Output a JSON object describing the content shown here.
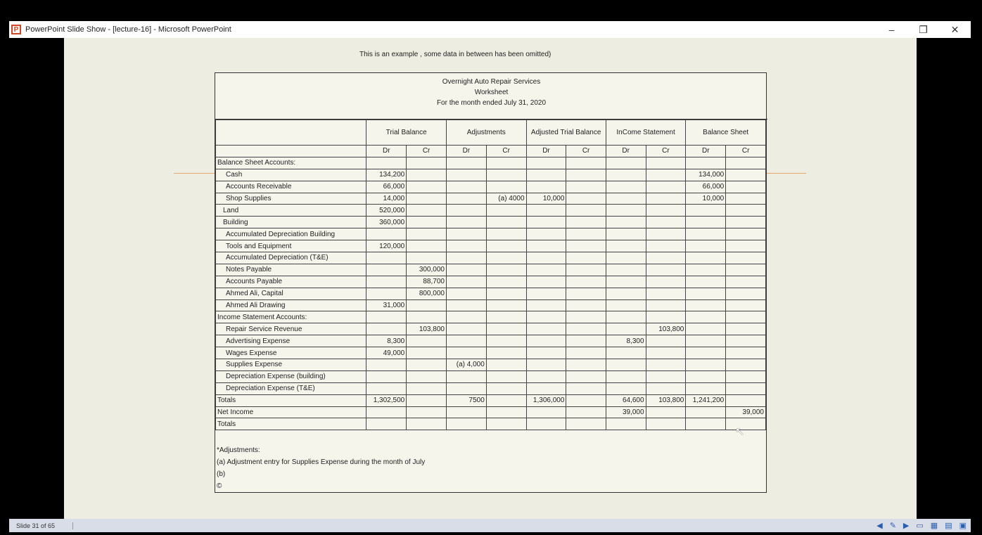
{
  "window": {
    "title": "PowerPoint Slide Show - [lecture-16] - Microsoft PowerPoint",
    "minimize": "–",
    "restore": "❐",
    "close": "✕"
  },
  "slide": {
    "note": "This is an example  , some data in between has been omitted)",
    "company": "Overnight Auto Repair Services",
    "doc_title": "Worksheet",
    "period": "For the month ended July  31, 2020",
    "col_groups": [
      "Trial Balance",
      "Adjustments",
      "Adjusted Trial Balance",
      "InCome Statement",
      "Balance Sheet"
    ],
    "dr": "Dr",
    "cr": "Cr",
    "rows": [
      {
        "label": "Balance Sheet Accounts:",
        "cls": "",
        "v": [
          "",
          "",
          "",
          "",
          "",
          "",
          "",
          "",
          "",
          ""
        ]
      },
      {
        "label": "Cash",
        "cls": "ind1",
        "v": [
          "134,200",
          "",
          "",
          "",
          "",
          "",
          "",
          "",
          "134,000",
          ""
        ]
      },
      {
        "label": "Accounts Receivable",
        "cls": "ind1",
        "v": [
          "66,000",
          "",
          "",
          "",
          "",
          "",
          "",
          "",
          "66,000",
          ""
        ]
      },
      {
        "label": "Shop Supplies",
        "cls": "ind1",
        "v": [
          "14,000",
          "",
          "",
          "(a)  4000",
          "10,000",
          "",
          "",
          "",
          "10,000",
          ""
        ]
      },
      {
        "label": "Land",
        "cls": "ind2",
        "v": [
          "520,000",
          "",
          "",
          "",
          "",
          "",
          "",
          "",
          "",
          ""
        ]
      },
      {
        "label": "Building",
        "cls": "ind2",
        "v": [
          "360,000",
          "",
          "",
          "",
          "",
          "",
          "",
          "",
          "",
          ""
        ]
      },
      {
        "label": "Accumulated Depreciation Building",
        "cls": "ind1",
        "v": [
          "",
          "",
          "",
          "",
          "",
          "",
          "",
          "",
          "",
          ""
        ]
      },
      {
        "label": "Tools and Equipment",
        "cls": "ind1",
        "v": [
          "120,000",
          "",
          "",
          "",
          "",
          "",
          "",
          "",
          "",
          ""
        ]
      },
      {
        "label": "Accumulated Depreciation (T&E)",
        "cls": "ind1",
        "v": [
          "",
          "",
          "",
          "",
          "",
          "",
          "",
          "",
          "",
          ""
        ]
      },
      {
        "label": "Notes Payable",
        "cls": "ind1",
        "v": [
          "",
          "300,000",
          "",
          "",
          "",
          "",
          "",
          "",
          "",
          ""
        ]
      },
      {
        "label": "Accounts Payable",
        "cls": "ind1",
        "v": [
          "",
          "88,700",
          "",
          "",
          "",
          "",
          "",
          "",
          "",
          ""
        ]
      },
      {
        "label": "Ahmed Ali, Capital",
        "cls": "ind1",
        "v": [
          "",
          "800,000",
          "",
          "",
          "",
          "",
          "",
          "",
          "",
          ""
        ]
      },
      {
        "label": "Ahmed Ali Drawing",
        "cls": "ind1",
        "v": [
          "31,000",
          "",
          "",
          "",
          "",
          "",
          "",
          "",
          "",
          ""
        ]
      },
      {
        "label": "Income Statement Accounts:",
        "cls": "",
        "v": [
          "",
          "",
          "",
          "",
          "",
          "",
          "",
          "",
          "",
          ""
        ]
      },
      {
        "label": "Repair Service Revenue",
        "cls": "ind1",
        "v": [
          "",
          "103,800",
          "",
          "",
          "",
          "",
          "",
          "103,800",
          "",
          ""
        ]
      },
      {
        "label": "Advertising Expense",
        "cls": "ind1",
        "v": [
          "8,300",
          "",
          "",
          "",
          "",
          "",
          "8,300",
          "",
          "",
          ""
        ]
      },
      {
        "label": "Wages Expense",
        "cls": "ind1",
        "v": [
          "49,000",
          "",
          "",
          "",
          "",
          "",
          "",
          "",
          "",
          ""
        ]
      },
      {
        "label": "Supplies Expense",
        "cls": "ind1",
        "v": [
          "",
          "",
          "(a)  4,000",
          "",
          "",
          "",
          "",
          "",
          "",
          ""
        ]
      },
      {
        "label": "Depreciation Expense (building)",
        "cls": "ind1",
        "v": [
          "",
          "",
          "",
          "",
          "",
          "",
          "",
          "",
          "",
          ""
        ]
      },
      {
        "label": "Depreciation Expense (T&E)",
        "cls": "ind1",
        "v": [
          "",
          "",
          "",
          "",
          "",
          "",
          "",
          "",
          "",
          ""
        ]
      },
      {
        "label": "Totals",
        "cls": "",
        "v": [
          "1,302,500",
          "",
          "7500",
          "",
          "1,306,000",
          "",
          "64,600",
          "103,800",
          "1,241,200",
          ""
        ]
      },
      {
        "label": "Net Income",
        "cls": "",
        "v": [
          "",
          "",
          "",
          "",
          "",
          "",
          "39,000",
          "",
          "",
          "39,000"
        ]
      },
      {
        "label": "Totals",
        "cls": "",
        "v": [
          "",
          "",
          "",
          "",
          "",
          "",
          "",
          "",
          "",
          ""
        ]
      }
    ],
    "footnotes": [
      "*Adjustments:",
      "(a)  Adjustment entry for Supplies Expense during the month of July",
      "(b)",
      "©"
    ],
    "logo": "C3"
  },
  "status": {
    "slide_num": "Slide 31 of 65"
  }
}
